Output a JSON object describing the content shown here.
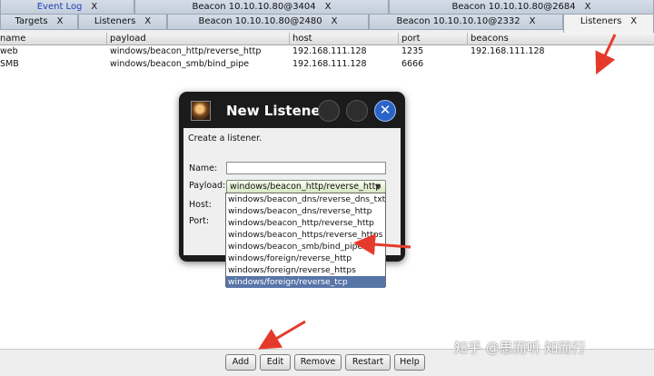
{
  "tabs_row1": [
    {
      "label": "Event Log",
      "close": "X",
      "active": false
    },
    {
      "label": "Beacon 10.10.10.80@3404",
      "close": "X",
      "active": false
    },
    {
      "label": "Beacon 10.10.10.80@2684",
      "close": "X",
      "active": false
    }
  ],
  "tabs_row2": [
    {
      "label": "Targets",
      "close": "X",
      "active": false
    },
    {
      "label": "Listeners",
      "close": "X",
      "active": false
    },
    {
      "label": "Beacon 10.10.10.80@2480",
      "close": "X",
      "active": false
    },
    {
      "label": "Beacon 10.10.10.10@2332",
      "close": "X",
      "active": false
    },
    {
      "label": "Listeners",
      "close": "X",
      "active": true
    }
  ],
  "table": {
    "columns": [
      "name",
      "payload",
      "host",
      "port",
      "beacons"
    ],
    "rows": [
      [
        "web",
        "windows/beacon_http/reverse_http",
        "192.168.111.128",
        "1235",
        "192.168.111.128"
      ],
      [
        "SMB",
        "windows/beacon_smb/bind_pipe",
        "192.168.111.128",
        "6666",
        ""
      ]
    ]
  },
  "dialog": {
    "title": "New Listene",
    "close_icon": "✕",
    "description": "Create a listener.",
    "name_label": "Name:",
    "name_value": "",
    "payload_label": "Payload:",
    "payload_value": "windows/beacon_http/reverse_http",
    "host_label": "Host:",
    "port_label": "Port:",
    "payload_options": [
      "windows/beacon_dns/reverse_dns_txt",
      "windows/beacon_dns/reverse_http",
      "windows/beacon_http/reverse_http",
      "windows/beacon_https/reverse_https",
      "windows/beacon_smb/bind_pipe",
      "windows/foreign/reverse_http",
      "windows/foreign/reverse_https",
      "windows/foreign/reverse_tcp"
    ],
    "highlighted_option": "windows/foreign/reverse_tcp"
  },
  "buttons": {
    "add": "Add",
    "edit": "Edit",
    "remove": "Remove",
    "restart": "Restart",
    "help": "Help"
  },
  "watermark": "知乎 @思而听 知而行",
  "colors": {
    "annotation_arrow": "#e53a2b",
    "selected_option": "#5875a8",
    "dialog_close": "#2a63c9"
  }
}
